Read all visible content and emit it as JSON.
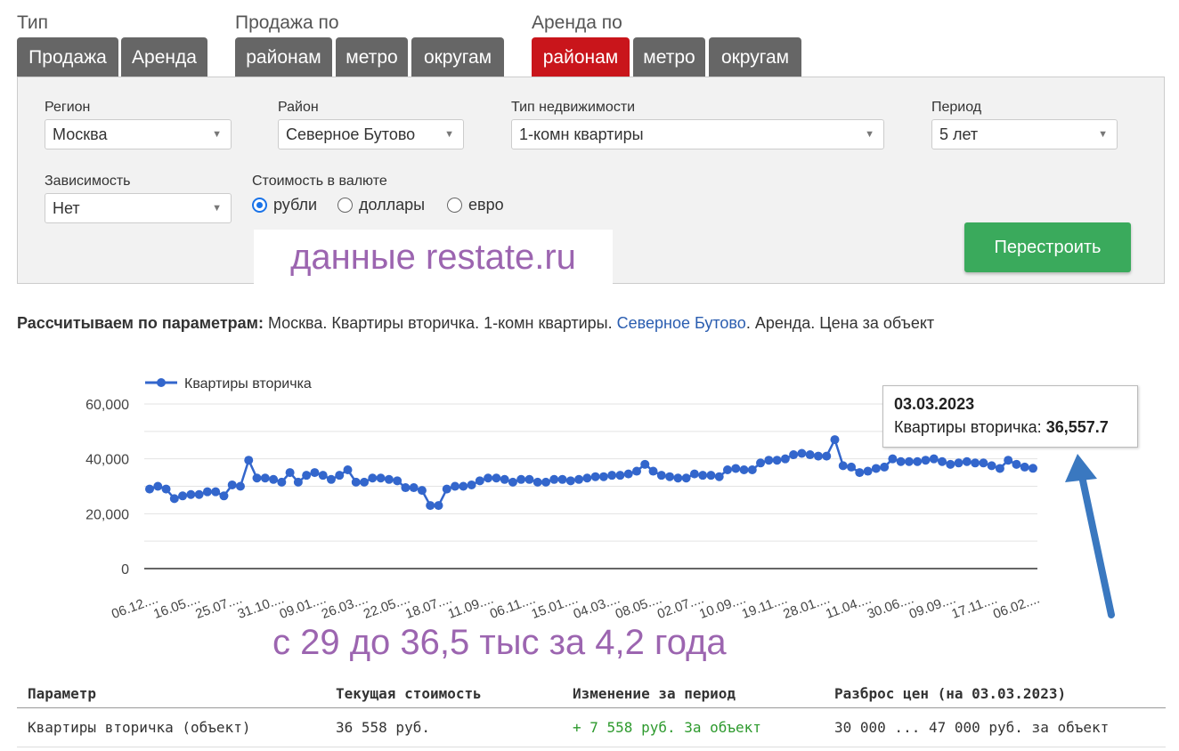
{
  "tabs": {
    "type_label": "Тип",
    "type_tabs": [
      "Продажа",
      "Аренда"
    ],
    "sale_label": "Продажа по",
    "sale_tabs": [
      "районам",
      "метро",
      "округам"
    ],
    "rent_label": "Аренда по",
    "rent_tabs": [
      "районам",
      "метро",
      "округам"
    ]
  },
  "filters": {
    "region_label": "Регион",
    "region_value": "Москва",
    "district_label": "Район",
    "district_value": "Северное Бутово",
    "type_label": "Тип недвижимости",
    "type_value": "1-комн квартиры",
    "period_label": "Период",
    "period_value": "5 лет",
    "dependency_label": "Зависимость",
    "dependency_value": "Нет",
    "currency_label": "Стоимость в валюте",
    "currency_options": [
      "рубли",
      "доллары",
      "евро"
    ],
    "currency_selected": "рубли",
    "rebuild_button": "Перестроить"
  },
  "watermark": "данные restate.ru",
  "params": {
    "label": "Рассчитываем по параметрам:",
    "text1": " Москва. Квартиры вторичка. 1-комн квартиры. ",
    "link": "Северное Бутово",
    "text2": ". Аренда. Цена за объект"
  },
  "tooltip": {
    "date": "03.03.2023",
    "series": "Квартиры вторичка:",
    "value": "36,557.7"
  },
  "annotation": "с 29 до 36,5 тыс за 4,2 года",
  "colors": {
    "line": "#3366cc",
    "active_tab": "#c9151b",
    "tab": "#666666",
    "button": "#3aaa5c",
    "annotation": "#9c65b0",
    "arrow": "#3a78c0"
  },
  "chart_data": {
    "type": "line",
    "legend": "Квартиры вторичка",
    "legend_position": "top-left",
    "ylim": [
      0,
      60000
    ],
    "yticks": [
      "0",
      "20,000",
      "40,000",
      "60,000"
    ],
    "grid": true,
    "x_tick_labels": [
      "06.12....",
      "16.05....",
      "25.07....",
      "31.10....",
      "09.01....",
      "26.03....",
      "22.05....",
      "18.07....",
      "11.09....",
      "06.11....",
      "15.01....",
      "04.03....",
      "08.05....",
      "02.07....",
      "10.09....",
      "19.11....",
      "28.01....",
      "11.04....",
      "30.06....",
      "09.09....",
      "17.11....",
      "06.02...."
    ],
    "series": [
      {
        "name": "Квартиры вторичка",
        "values": [
          29000,
          30000,
          29000,
          25500,
          26500,
          27000,
          27000,
          28000,
          28000,
          26500,
          30500,
          30000,
          39500,
          33000,
          33000,
          32500,
          31500,
          35000,
          31500,
          34000,
          35000,
          34000,
          32500,
          34000,
          36000,
          31500,
          31500,
          33000,
          33000,
          32500,
          32000,
          29500,
          29500,
          28500,
          23000,
          23000,
          29000,
          30000,
          30000,
          30500,
          32000,
          33000,
          33000,
          32500,
          31500,
          32500,
          32500,
          31500,
          31500,
          32500,
          32500,
          32000,
          32500,
          33000,
          33500,
          33500,
          34000,
          34000,
          34500,
          35500,
          38000,
          35500,
          34000,
          33500,
          33000,
          33000,
          34500,
          34000,
          34000,
          33500,
          36000,
          36500,
          36000,
          36000,
          38500,
          39500,
          39500,
          40000,
          41500,
          42000,
          41500,
          41000,
          41000,
          47000,
          37500,
          37000,
          35000,
          35500,
          36500,
          37000,
          40000,
          39000,
          39000,
          39000,
          39500,
          40000,
          39000,
          38000,
          38500,
          39000,
          38500,
          38500,
          37500,
          36500,
          39500,
          38000,
          37000,
          36558
        ]
      }
    ]
  },
  "table": {
    "headers": [
      "Параметр",
      "Текущая стоимость",
      "Изменение за период",
      "Разброс цен (на 03.03.2023)"
    ],
    "rows": [
      [
        "Квартиры вторичка (объект)",
        "36 558 руб.",
        "+ 7 558 руб. За объект",
        "30 000 ... 47 000 руб. за объект"
      ]
    ]
  }
}
